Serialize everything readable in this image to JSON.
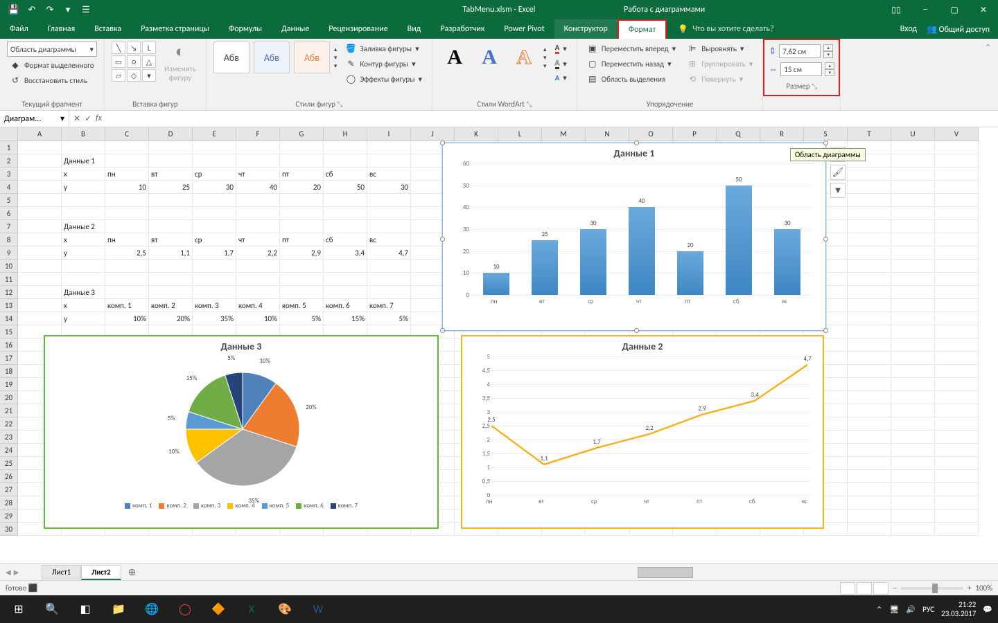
{
  "app": {
    "filename": "TabMenu.xlsm - Excel",
    "context_title": "Работа с диаграммами"
  },
  "qat": {
    "save": "💾",
    "undo": "↶",
    "redo": "↷",
    "touch": "☰"
  },
  "win": {
    "options": "⋯",
    "min": "─",
    "max": "▢",
    "close": "✕"
  },
  "tabs": {
    "file": "Файл",
    "home": "Главная",
    "insert": "Вставка",
    "page": "Разметка страницы",
    "formulas": "Формулы",
    "data": "Данные",
    "review": "Рецензирование",
    "view": "Вид",
    "developer": "Разработчик",
    "powerpivot": "Power Pivot",
    "ctx_design": "Конструктор",
    "ctx_format": "Формат",
    "tellme_placeholder": "Что вы хотите сделать?",
    "signin": "Вход",
    "share": "Общий доступ"
  },
  "ribbon": {
    "selection": {
      "combo": "Область диаграммы",
      "format_sel": "Формат выделенного",
      "reset": "Восстановить стиль",
      "label": "Текущий фрагмент"
    },
    "shapes": {
      "change": "Изменить\nфигуру",
      "label": "Вставка фигур"
    },
    "styles": {
      "fill": "Заливка фигуры",
      "outline": "Контур фигуры",
      "effects": "Эффекты фигуры",
      "label": "Стили фигур",
      "sample": "Абв"
    },
    "wordart": {
      "label": "Стили WordArt",
      "fill": "А",
      "outline": "А",
      "effects": "А"
    },
    "arrange": {
      "forward": "Переместить вперед",
      "back": "Переместить назад",
      "pane": "Область выделения",
      "align": "Выровнять",
      "group": "Группировать",
      "rotate": "Повернуть",
      "label": "Упорядочение"
    },
    "size": {
      "height": "7,62 см",
      "width": "15 см",
      "label": "Размер"
    }
  },
  "formula": {
    "name": "Диаграм...",
    "fx": "fx",
    "value": ""
  },
  "columns": [
    "A",
    "B",
    "C",
    "D",
    "E",
    "F",
    "G",
    "H",
    "I",
    "J",
    "K",
    "L",
    "M",
    "N",
    "O",
    "P",
    "Q",
    "R",
    "S",
    "T",
    "U",
    "V"
  ],
  "rows": 30,
  "cells": {
    "B2": "Данные 1",
    "B3": "x",
    "C3": "пн",
    "D3": "вт",
    "E3": "ср",
    "F3": "чт",
    "G3": "пт",
    "H3": "сб",
    "I3": "вс",
    "B4": "y",
    "C4": "10",
    "D4": "25",
    "E4": "30",
    "F4": "40",
    "G4": "20",
    "H4": "50",
    "I4": "30",
    "B7": "Данные 2",
    "B8": "x",
    "C8": "пн",
    "D8": "вт",
    "E8": "ср",
    "F8": "чт",
    "G8": "пт",
    "H8": "сб",
    "I8": "вс",
    "B9": "y",
    "C9": "2,5",
    "D9": "1,1",
    "E9": "1,7",
    "F9": "2,2",
    "G9": "2,9",
    "H9": "3,4",
    "I9": "4,7",
    "B12": "Данные 3",
    "B13": "x",
    "C13": "комп. 1",
    "D13": "комп. 2",
    "E13": "комп. 3",
    "F13": "комп. 4",
    "G13": "комп. 5",
    "H13": "комп. 6",
    "I13": "комп. 7",
    "B14": "y",
    "C14": "10%",
    "D14": "20%",
    "E14": "35%",
    "F14": "10%",
    "G14": "5%",
    "H14": "15%",
    "I14": "5%"
  },
  "tooltip": "Область диаграммы",
  "chart_data": [
    {
      "type": "bar",
      "title": "Данные 1",
      "categories": [
        "пн",
        "вт",
        "ср",
        "чт",
        "пт",
        "сб",
        "вс"
      ],
      "values": [
        10,
        25,
        30,
        40,
        20,
        50,
        30
      ],
      "ylim": [
        0,
        60
      ],
      "yticks": [
        0,
        10,
        20,
        30,
        40,
        50,
        60
      ]
    },
    {
      "type": "line",
      "title": "Данные 2",
      "categories": [
        "пн",
        "вт",
        "ср",
        "чт",
        "пт",
        "сб",
        "вс"
      ],
      "values": [
        2.5,
        1.1,
        1.7,
        2.2,
        2.9,
        3.4,
        4.7
      ],
      "values_display": [
        "2,5",
        "1,1",
        "1,7",
        "2,2",
        "2,9",
        "3,4",
        "4,7"
      ],
      "ylim": [
        0,
        5
      ],
      "yticks": [
        "0",
        "0,5",
        "1",
        "1,5",
        "2",
        "2,5",
        "3",
        "3,5",
        "4",
        "4,5",
        "5"
      ]
    },
    {
      "type": "pie",
      "title": "Данные 3",
      "categories": [
        "комп. 1",
        "комп. 2",
        "комп. 3",
        "комп. 4",
        "комп. 5",
        "комп. 6",
        "комп. 7"
      ],
      "values": [
        10,
        20,
        35,
        10,
        5,
        15,
        5
      ],
      "labels": [
        "10%",
        "20%",
        "35%",
        "10%",
        "5%",
        "15%",
        "5%"
      ],
      "colors": [
        "#4f81bd",
        "#ed7d31",
        "#a5a5a5",
        "#ffc000",
        "#5b9bd5",
        "#70ad47",
        "#264478"
      ]
    }
  ],
  "sheets": {
    "s1": "Лист1",
    "s2": "Лист2",
    "add": "⊕"
  },
  "status": {
    "ready": "Готово",
    "zoom": "100%",
    "rec": "⬛"
  },
  "tray": {
    "lang": "РУС",
    "time": "21:22",
    "date": "23.03.2017"
  }
}
